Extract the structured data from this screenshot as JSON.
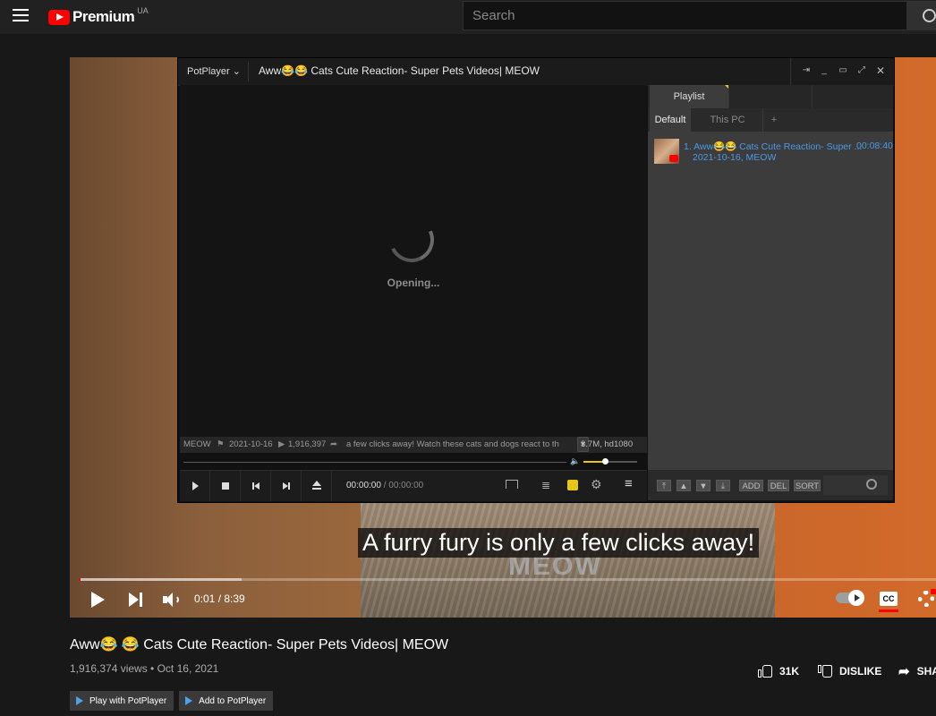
{
  "header": {
    "brand": "Premium",
    "country_code": "UA",
    "search_placeholder": "Search"
  },
  "player": {
    "subtitle": "A furry fury is only a few clicks away!",
    "watermark": "MEOW",
    "time_current": "0:01",
    "time_total": "8:39",
    "time_display": "0:01 / 8:39",
    "progress_played_fraction": 0.0012,
    "progress_loaded_fraction": 0.19,
    "cc_label": "CC"
  },
  "potplayer": {
    "menu_label": "PotPlayer",
    "window_title": "Aww😂😂 Cats Cute Reaction- Super Pets Videos| MEOW",
    "status_text": "Opening...",
    "info_channel": "MEOW",
    "info_date": "2021-10-16",
    "info_views": "1,916,397",
    "info_desc": "a few clicks away! Watch these cats and dogs react to th",
    "info_quality": "3.7M, hd1080",
    "time_current": "00:00:00",
    "time_total": "00:00:00",
    "volume_fraction": 0.4,
    "playlist": {
      "tab_label": "Playlist",
      "subtabs": [
        "Default",
        "This PC",
        "+"
      ],
      "items": [
        {
          "title": "1. Aww😂😂 Cats Cute Reaction- Super ...",
          "duration": "00:08:40",
          "meta": "2021-10-16, MEOW"
        }
      ],
      "buttons": [
        "ADD",
        "DEL",
        "SORT"
      ]
    }
  },
  "video_info": {
    "title": "Aww😂 😂 Cats Cute Reaction- Super Pets Videos| MEOW",
    "meta": "1,916,374 views • Oct 16, 2021",
    "likes": "31K",
    "dislike_label": "DISLIKE",
    "share_label": "SHARE"
  },
  "extension": {
    "play_label": "Play with PotPlayer",
    "add_label": "Add to PotPlayer"
  },
  "colors": {
    "accent_red": "#ff0000",
    "potplayer_yellow": "#e6c619",
    "playlist_link_blue": "#4a9ae8"
  }
}
